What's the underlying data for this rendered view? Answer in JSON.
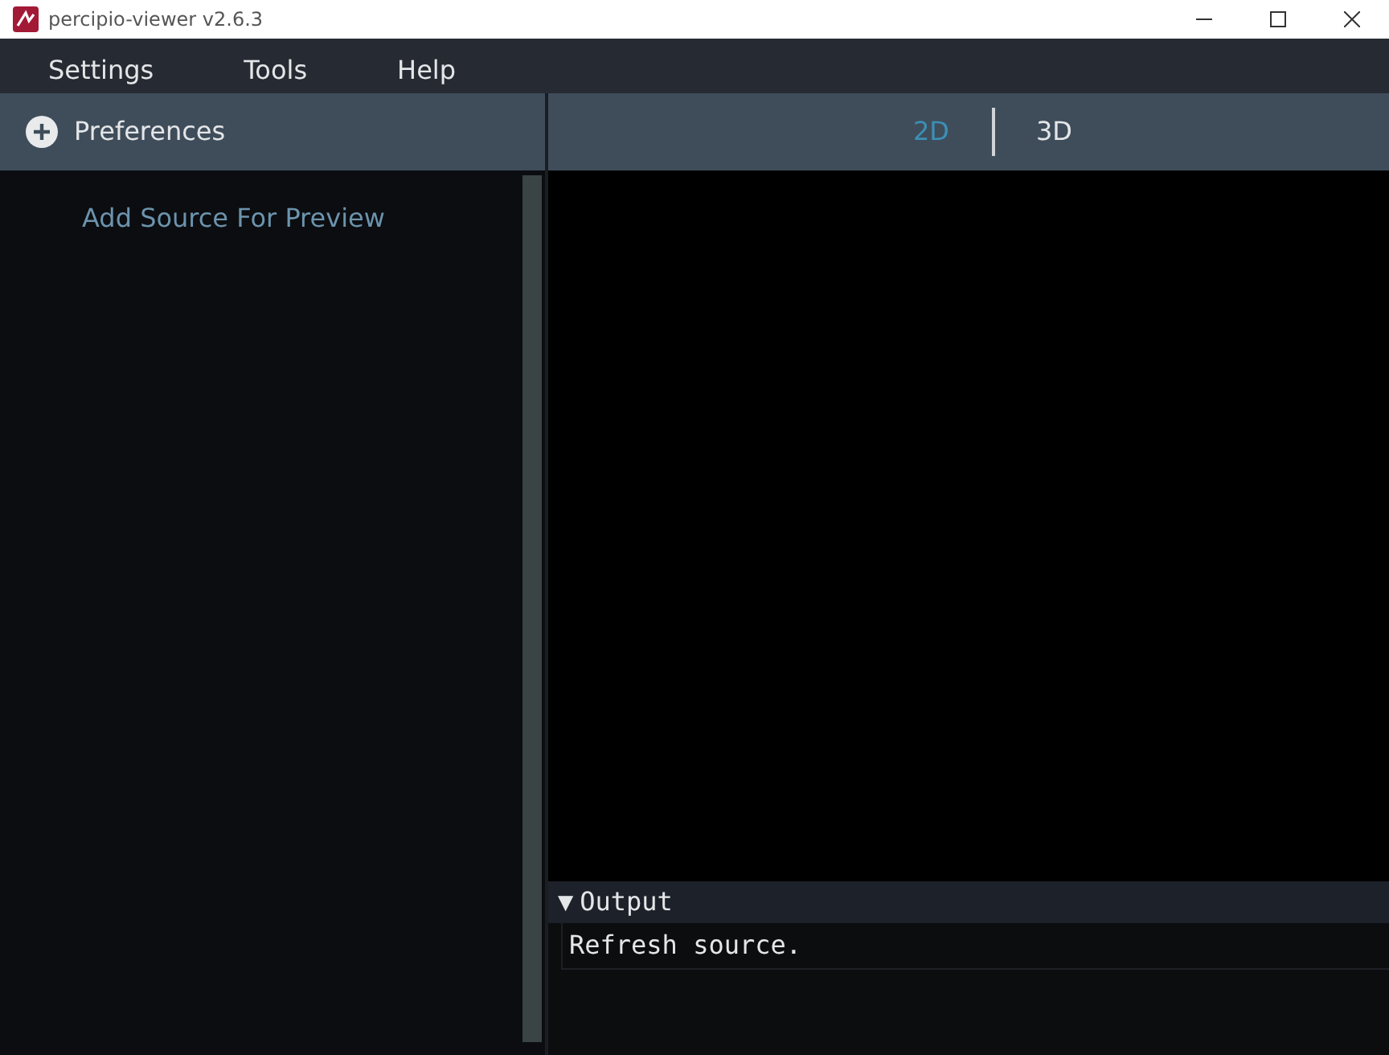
{
  "window": {
    "title": "percipio-viewer v2.6.3"
  },
  "menu": [
    "Settings",
    "Tools",
    "Help"
  ],
  "sidebar": {
    "header": "Preferences",
    "link": "Add Source For Preview"
  },
  "view_tabs": [
    {
      "label": "2D",
      "selected": true
    },
    {
      "label": "3D",
      "selected": false
    }
  ],
  "output": {
    "toggle": "▼",
    "title": "Output",
    "expanded": true,
    "lines": [
      "Refresh source."
    ]
  }
}
